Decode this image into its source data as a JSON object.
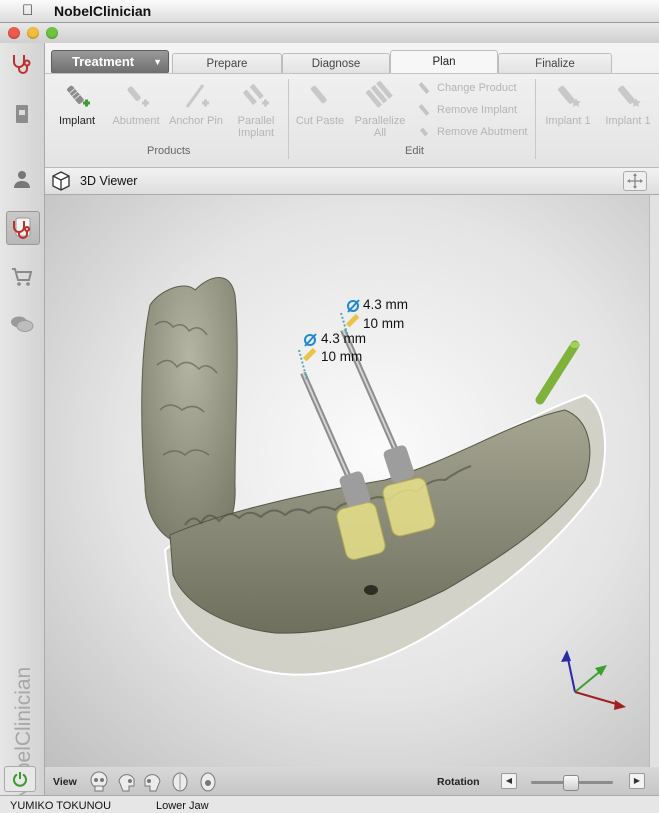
{
  "app": {
    "name": "NobelClinician"
  },
  "brand_vertical": "NobelClinician",
  "sidebar": {
    "items": [
      {
        "icon": "stethoscope-icon",
        "active": false
      },
      {
        "icon": "document-icon",
        "active": false
      },
      {
        "icon": "patient-icon",
        "active": false
      },
      {
        "icon": "treatment-icon",
        "active": true
      },
      {
        "icon": "cart-icon",
        "active": false
      },
      {
        "icon": "chat-icon",
        "active": false
      }
    ],
    "power_icon": "power-icon"
  },
  "ribbon": {
    "mode_button": "Treatment",
    "tabs": [
      {
        "label": "Prepare",
        "active": false
      },
      {
        "label": "Diagnose",
        "active": false
      },
      {
        "label": "Plan",
        "active": true
      },
      {
        "label": "Finalize",
        "active": false
      }
    ],
    "products": {
      "label": "Products",
      "tools": [
        {
          "label": "Implant",
          "enabled": true
        },
        {
          "label": "Abutment",
          "enabled": false
        },
        {
          "label": "Anchor Pin",
          "enabled": false
        },
        {
          "label": "Parallel Implant",
          "enabled": false
        }
      ]
    },
    "edit": {
      "label": "Edit",
      "tools": [
        {
          "label": "Cut Paste",
          "enabled": false
        },
        {
          "label": "Parallelize All",
          "enabled": false
        }
      ],
      "small_tools": [
        "Change Product",
        "Remove Implant",
        "Remove Abutment"
      ]
    },
    "implant_tools": [
      {
        "label": "Implant 1",
        "enabled": false
      },
      {
        "label": "Implant 1",
        "enabled": false
      }
    ]
  },
  "viewer": {
    "title": "3D Viewer",
    "measurements": [
      {
        "diameter": "4.3 mm",
        "length": "10 mm"
      },
      {
        "diameter": "4.3 mm",
        "length": "10 mm"
      }
    ],
    "colors": {
      "implant": "#e7e08a",
      "bone": "#8f8f7a",
      "guide_pin": "#7fb23a",
      "axis_x": "#a02020",
      "axis_y": "#3aa12e",
      "axis_z": "#2a2aa8"
    }
  },
  "viewbar": {
    "view_label": "View",
    "view_buttons": [
      "skull-front-icon",
      "skull-left-icon",
      "skull-right-icon",
      "skull-top-icon",
      "skull-bottom-icon"
    ],
    "rotation_label": "Rotation",
    "rotation_level": 0.5
  },
  "status": {
    "patient": "YUMIKO TOKUNOU",
    "jaw": "Lower Jaw"
  }
}
